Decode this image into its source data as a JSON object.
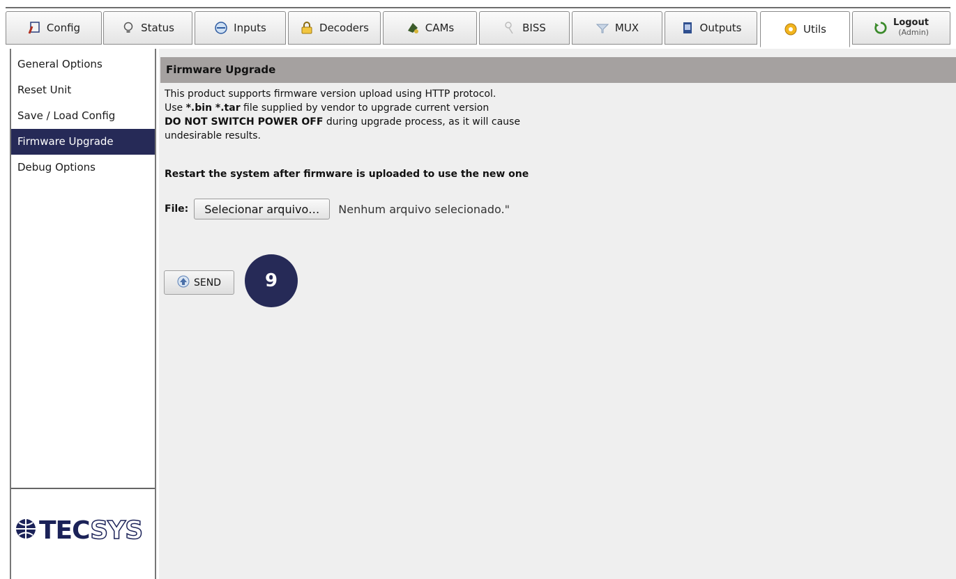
{
  "tabs": [
    {
      "label": "Config",
      "icon": "config-icon"
    },
    {
      "label": "Status",
      "icon": "bulb-icon"
    },
    {
      "label": "Inputs",
      "icon": "inputs-icon"
    },
    {
      "label": "Decoders",
      "icon": "lock-icon"
    },
    {
      "label": "CAMs",
      "icon": "cam-icon"
    },
    {
      "label": "BISS",
      "icon": "key-icon"
    },
    {
      "label": "MUX",
      "icon": "funnel-icon"
    },
    {
      "label": "Outputs",
      "icon": "outputs-icon"
    },
    {
      "label": "Utils",
      "icon": "utils-icon",
      "active": true
    }
  ],
  "logout": {
    "label": "Logout",
    "user": "(Admin)"
  },
  "sidebar": {
    "items": [
      {
        "label": "General Options"
      },
      {
        "label": "Reset Unit"
      },
      {
        "label": "Save / Load Config"
      },
      {
        "label": "Firmware Upgrade",
        "selected": true
      },
      {
        "label": "Debug Options"
      }
    ],
    "logo": {
      "prefix": "TEC",
      "suffix": "SYS"
    }
  },
  "main": {
    "header": "Firmware Upgrade",
    "line1": "This product supports firmware version upload using HTTP protocol.",
    "line2_pre": "Use ",
    "line2_bold": "*.bin *.tar",
    "line2_post": " file supplied by vendor to upgrade current version",
    "line3_bold": "DO NOT SWITCH POWER OFF",
    "line3_post": " during upgrade process, as it will cause",
    "line4": "undesirable results.",
    "restart": "Restart the system after firmware is uploaded to use the new one",
    "file_label": "File:",
    "file_button": "Selecionar arquivo…",
    "file_status": "Nenhum arquivo selecionado.\"",
    "send_label": "SEND",
    "callout": "9"
  },
  "colors": {
    "accent": "#262a57",
    "header_bar": "#a5a1a0",
    "content_bg": "#efefef"
  }
}
